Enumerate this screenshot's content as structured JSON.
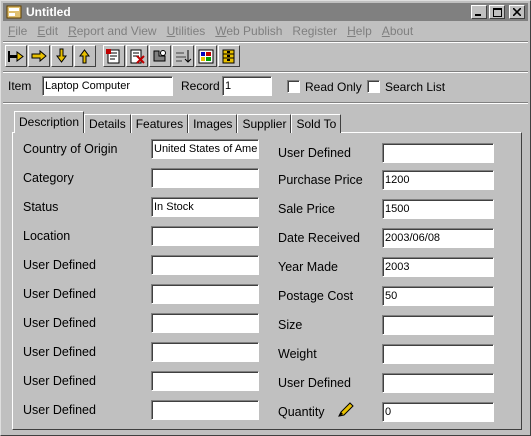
{
  "window": {
    "title": "Untitled"
  },
  "menu": [
    {
      "label": "File",
      "u": "F",
      "rest": "ile"
    },
    {
      "label": "Edit",
      "u": "E",
      "rest": "dit"
    },
    {
      "label": "Report and View",
      "u": "R",
      "rest": "eport and View"
    },
    {
      "label": "Utilities",
      "u": "U",
      "rest": "tilities"
    },
    {
      "label": "Web Publish",
      "u": "W",
      "rest": "eb Publish"
    },
    {
      "label": "Register",
      "u": "",
      "rest": "Register"
    },
    {
      "label": "Help",
      "u": "H",
      "rest": "elp"
    },
    {
      "label": "About",
      "u": "A",
      "rest": "bout"
    }
  ],
  "toolbar": {
    "icons": [
      "first-record-icon",
      "previous-record-icon",
      "next-record-icon",
      "last-record-icon",
      "new-record-icon",
      "delete-record-icon",
      "find-icon",
      "sort-icon",
      "report-icon",
      "database-icon"
    ]
  },
  "item_bar": {
    "item_label": "Item",
    "item_value": "Laptop Computer",
    "record_label": "Record",
    "record_value": "1",
    "read_only_label": "Read Only",
    "search_list_label": "Search List"
  },
  "tabs": [
    "Description",
    "Details",
    "Features",
    "Images",
    "Supplier",
    "Sold To"
  ],
  "left_fields": [
    {
      "label": "Country of Origin",
      "value": "United States of Amer"
    },
    {
      "label": "Category",
      "value": ""
    },
    {
      "label": "Status",
      "value": "In Stock"
    },
    {
      "label": "Location",
      "value": ""
    },
    {
      "label": "User Defined",
      "value": ""
    },
    {
      "label": "User Defined",
      "value": ""
    },
    {
      "label": "User Defined",
      "value": ""
    },
    {
      "label": "User Defined",
      "value": ""
    },
    {
      "label": "User Defined",
      "value": ""
    },
    {
      "label": "User Defined",
      "value": ""
    }
  ],
  "right_fields": [
    {
      "label": "User Defined",
      "value": ""
    },
    {
      "label": "Purchase Price",
      "value": "1200"
    },
    {
      "label": "Sale Price",
      "value": "1500"
    },
    {
      "label": "Date Received",
      "value": "2003/06/08"
    },
    {
      "label": "Year Made",
      "value": "2003"
    },
    {
      "label": "Postage Cost",
      "value": "50"
    },
    {
      "label": "Size",
      "value": ""
    },
    {
      "label": "Weight",
      "value": ""
    },
    {
      "label": "User Defined",
      "value": ""
    },
    {
      "label": "Quantity",
      "value": "0"
    }
  ]
}
